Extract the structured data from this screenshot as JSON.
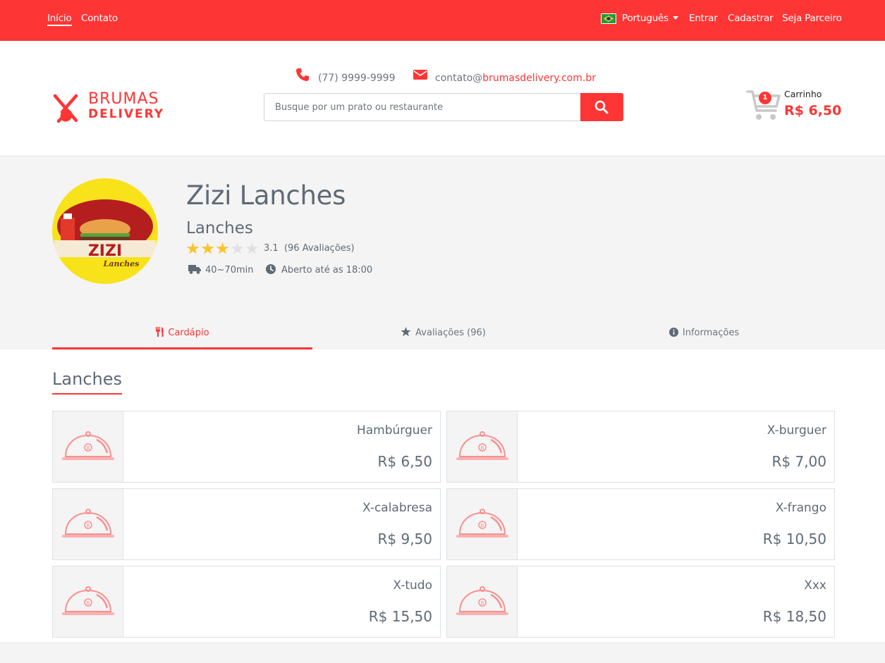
{
  "topnav": {
    "left_links": [
      "Início",
      "Contato"
    ],
    "language": "Português",
    "right_links": [
      "Entrar",
      "Cadastrar",
      "Seja Parceiro"
    ]
  },
  "header": {
    "logo_line1": "BRUMAS",
    "logo_line2": "DELIVERY",
    "phone": "(77) 9999-9999",
    "email_prefix": "contato@",
    "email_domain": "brumasdelivery.com.br",
    "search_placeholder": "Busque por um prato ou restaurante",
    "cart": {
      "count": "1",
      "label": "Carrinho",
      "total": "R$ 6,50"
    }
  },
  "restaurant": {
    "name": "Zizi Lanches",
    "category": "Lanches",
    "rating_value": 3.1,
    "rating_text": "3.1",
    "reviews_text": "(96 Avaliações)",
    "stars_filled": 3,
    "stars_total": 5,
    "delivery_time": "40~70min",
    "hours": "Aberto até as 18:00",
    "logo_text": "ZIZI",
    "logo_sub": "Lanches"
  },
  "tabs": [
    {
      "label": "Cardápio",
      "icon": "utensils-icon",
      "active": true
    },
    {
      "label": "Avaliações (96)",
      "icon": "star-icon",
      "active": false
    },
    {
      "label": "Informações",
      "icon": "info-icon",
      "active": false
    }
  ],
  "menu": {
    "section": "Lanches",
    "items": [
      {
        "name": "Hambúrguer",
        "price": "R$ 6,50"
      },
      {
        "name": "X-burguer",
        "price": "R$ 7,00"
      },
      {
        "name": "X-calabresa",
        "price": "R$ 9,50"
      },
      {
        "name": "X-frango",
        "price": "R$ 10,50"
      },
      {
        "name": "X-tudo",
        "price": "R$ 15,50"
      },
      {
        "name": "Xxx",
        "price": "R$ 18,50"
      }
    ]
  },
  "colors": {
    "brand": "#fe3535",
    "star": "#fcc22a",
    "text": "#5f6a76"
  }
}
